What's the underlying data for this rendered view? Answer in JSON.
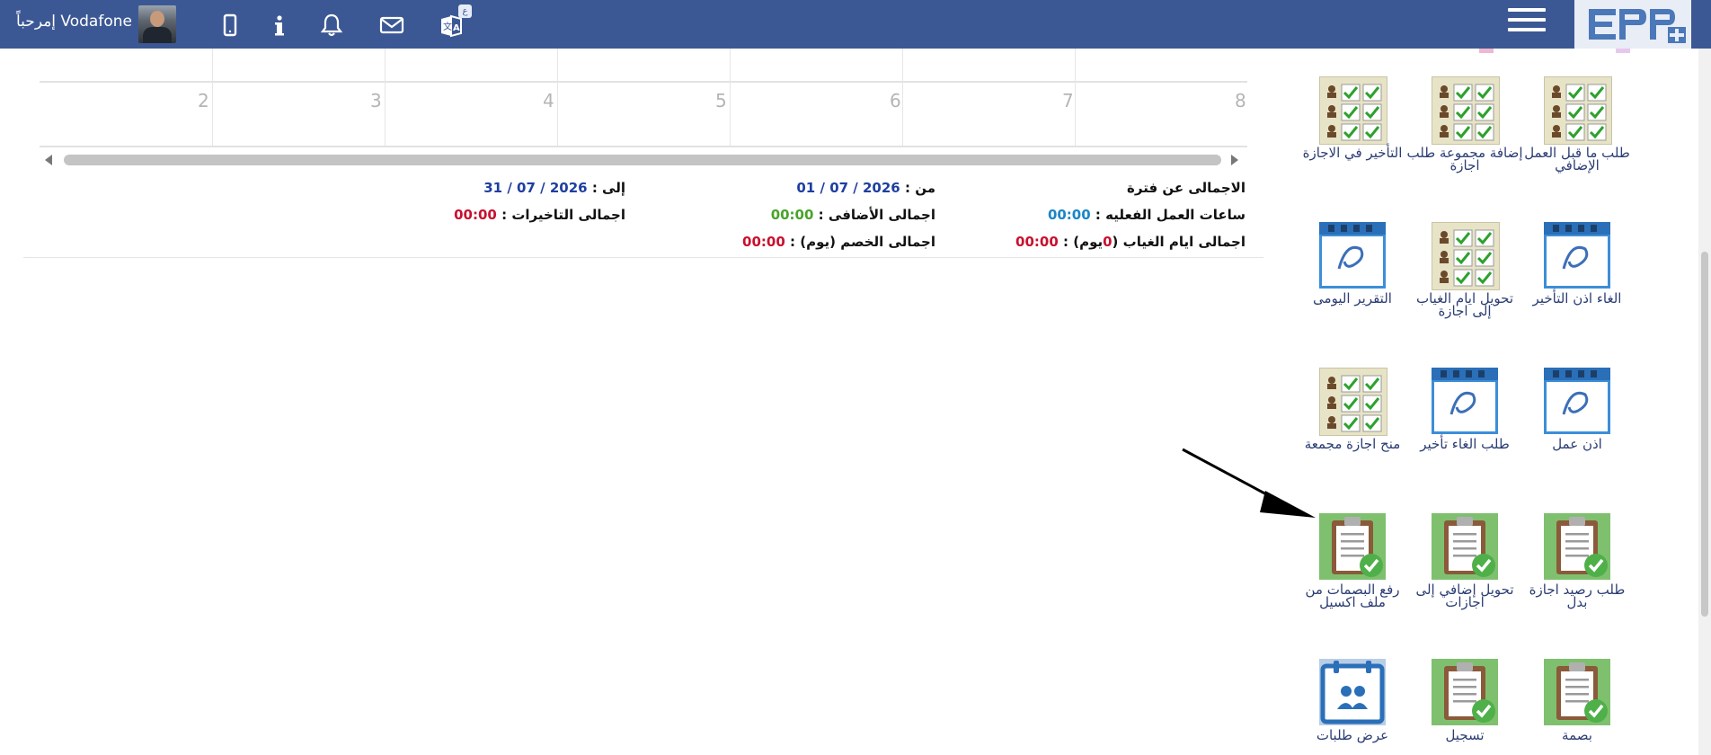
{
  "header": {
    "greeting": "إمرحباً Vodafone",
    "icons": [
      "mobile-icon",
      "info-icon",
      "bell-icon",
      "mail-icon",
      "translate-icon",
      "hamburger-menu-icon",
      "erp-logo"
    ],
    "lang_badge": "ع",
    "bar_color": "#3c5894"
  },
  "calendar": {
    "day_numbers": [
      "8",
      "7",
      "6",
      "5",
      "4",
      "3",
      "2"
    ]
  },
  "totals": {
    "period_label": "الاجمالى عن فترة",
    "from_label": "من :",
    "from_value": "2026 / 07 / 01",
    "to_label": "إلى :",
    "to_value": "2026 / 07 / 31",
    "actual_hours_label": "ساعات العمل الفعليه :",
    "actual_hours_value": "00:00",
    "overtime_label": "اجمالى الأضافى :",
    "overtime_value": "00:00",
    "delays_label": "اجمالى التاخيرات :",
    "delays_value": "00:00",
    "absence_label_pre": "اجمالى ايام الغياب (",
    "absence_days": "0",
    "absence_label_post": "يوم) :",
    "absence_value": "00:00",
    "deduction_label": "اجمالى الخصم (يوم) :",
    "deduction_value": "00:00"
  },
  "menu_tiles": [
    {
      "label": "طلب ما قبل العمل الإضافي",
      "icon": "checklist-icon"
    },
    {
      "label": "إضافة مجموعة طلب اجازة",
      "icon": "checklist-icon"
    },
    {
      "label": "التأخير في الاجازة",
      "icon": "checklist-icon"
    },
    {
      "label": "الغاء اذن التأخير",
      "icon": "calendar-icon"
    },
    {
      "label": "تحويل ايام الغياب إلى اجازة",
      "icon": "checklist-icon"
    },
    {
      "label": "التقرير اليومى",
      "icon": "calendar-icon"
    },
    {
      "label": "اذن عمل",
      "icon": "calendar-icon"
    },
    {
      "label": "طلب الغاء تأخير",
      "icon": "calendar-icon"
    },
    {
      "label": "منح اجازة مجمعة",
      "icon": "checklist-icon"
    },
    {
      "label": "طلب رصيد اجازة بدل",
      "icon": "clipboard-check-icon"
    },
    {
      "label": "تحويل إضافي إلى اجازات",
      "icon": "clipboard-check-icon"
    },
    {
      "label": "رفع البصمات من ملف اكسيل",
      "icon": "clipboard-check-icon"
    },
    {
      "label": "بصمة",
      "icon": "clipboard-check-icon"
    },
    {
      "label": "تسجيل",
      "icon": "clipboard-check-icon"
    },
    {
      "label": "عرض طلبات",
      "icon": "calendar-people-icon"
    }
  ]
}
